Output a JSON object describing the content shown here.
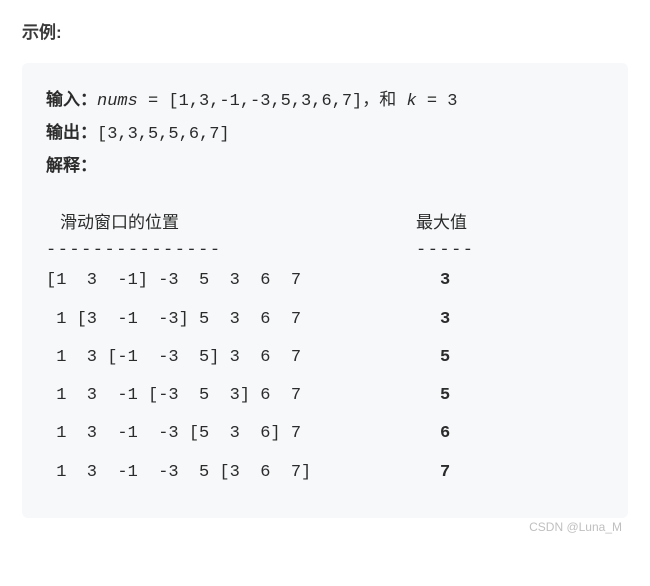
{
  "heading": "示例:",
  "input": {
    "label": "输入：",
    "var1": "nums",
    "eq1": " = ",
    "arr": "[1,3,-1,-3,5,3,6,7]",
    "sep": "，和 ",
    "var2": "k",
    "eq2": " = ",
    "val2": "3"
  },
  "output": {
    "label": "输出：",
    "value": "[3,3,5,5,6,7]"
  },
  "explain": {
    "label": "解释："
  },
  "table": {
    "col_left_title": "滑动窗口的位置",
    "col_right_title": "最大值",
    "divider_left": "---------------",
    "divider_right": "-----",
    "rows": [
      {
        "window": "[1  3  -1] -3  5  3  6  7",
        "max": "3"
      },
      {
        "window": " 1 [3  -1  -3] 5  3  6  7",
        "max": "3"
      },
      {
        "window": " 1  3 [-1  -3  5] 3  6  7",
        "max": "5"
      },
      {
        "window": " 1  3  -1 [-3  5  3] 6  7",
        "max": "5"
      },
      {
        "window": " 1  3  -1  -3 [5  3  6] 7",
        "max": "6"
      },
      {
        "window": " 1  3  -1  -3  5 [3  6  7]",
        "max": "7"
      }
    ]
  },
  "watermark": "CSDN @Luna_M",
  "chart_data": {
    "type": "table",
    "title": "Sliding Window Maximum Example",
    "input_array": [
      1,
      3,
      -1,
      -3,
      5,
      3,
      6,
      7
    ],
    "k": 3,
    "output_array": [
      3,
      3,
      5,
      5,
      6,
      7
    ],
    "columns": [
      "滑动窗口的位置",
      "最大值"
    ],
    "positions": [
      {
        "window_start": 0,
        "window_end": 2,
        "window_values": [
          1,
          3,
          -1
        ],
        "max": 3
      },
      {
        "window_start": 1,
        "window_end": 3,
        "window_values": [
          3,
          -1,
          -3
        ],
        "max": 3
      },
      {
        "window_start": 2,
        "window_end": 4,
        "window_values": [
          -1,
          -3,
          5
        ],
        "max": 5
      },
      {
        "window_start": 3,
        "window_end": 5,
        "window_values": [
          -3,
          5,
          3
        ],
        "max": 5
      },
      {
        "window_start": 4,
        "window_end": 6,
        "window_values": [
          5,
          3,
          6
        ],
        "max": 6
      },
      {
        "window_start": 5,
        "window_end": 7,
        "window_values": [
          3,
          6,
          7
        ],
        "max": 7
      }
    ]
  }
}
